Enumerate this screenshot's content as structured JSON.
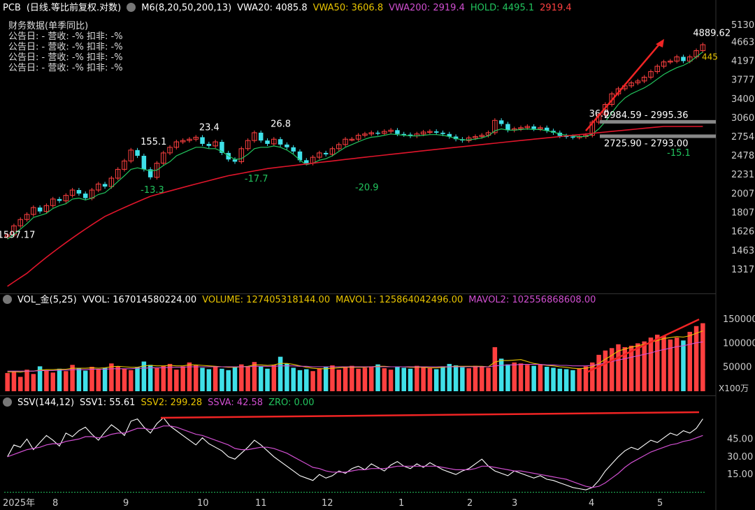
{
  "header": {
    "symbol": "PCB",
    "mode": "(日线.等比前复权.对数)",
    "m6": "M6(8,20,50,200,13)",
    "vwa20": "VWA20: 4085.8",
    "vwa50": "VWA50: 3606.8",
    "vwa200": "VWA200: 2919.4",
    "hold": "HOLD: 4495.1",
    "holdval": "2919.4"
  },
  "fin": {
    "title": "财务数据(单季同比)",
    "rows": [
      "公告日: -   营收: -%   扣非: -%",
      "公告日: -   营收: -%   扣非: -%",
      "公告日: -   营收: -%   扣非: -%",
      "公告日: -   营收: -%   扣非: -%"
    ]
  },
  "vol_header": {
    "name": "VOL_金(5,25)",
    "vvol": "VVOL: 167014580224.00",
    "volume": "VOLUME: 127405318144.00",
    "mavol1": "MAVOL1: 125864042496.00",
    "mavol2": "MAVOL2: 102556868608.00"
  },
  "ssv_header": {
    "name": "SSV(144,12)",
    "ssv1": "SSV1: 55.61",
    "ssv2": "SSV2: 299.28",
    "ssva": "SSVA: 42.58",
    "zro": "ZRO: 0.00"
  },
  "colors": {
    "up": "#ff4040",
    "down": "#3fe0e8",
    "green": "#22c55e",
    "ma200": "#e0152b",
    "yellow": "#e8c400",
    "magenta": "#d14fd1",
    "white": "#ffffff",
    "axis": "#cccccc",
    "arrow": "#f02424"
  },
  "chart_data": [
    {
      "type": "candlestick",
      "scale": "log",
      "ylim": [
        1190,
        5500
      ],
      "yticks": [
        1317,
        1463,
        1626,
        1807,
        2007,
        2231,
        2478,
        2754,
        3060,
        3400,
        3777,
        4197,
        4663,
        5130
      ],
      "xlabels": [
        "2025年",
        "8",
        "9",
        "10",
        "11",
        "12",
        "1",
        "2",
        "3",
        "4",
        "5"
      ],
      "close_series": [
        1597,
        1680,
        1740,
        1790,
        1860,
        1820,
        1880,
        1950,
        1930,
        1990,
        2050,
        2010,
        1960,
        2050,
        2120,
        2090,
        2190,
        2300,
        2410,
        2560,
        2480,
        2300,
        2200,
        2380,
        2520,
        2600,
        2680,
        2700,
        2720,
        2750,
        2650,
        2620,
        2680,
        2520,
        2430,
        2400,
        2580,
        2700,
        2820,
        2700,
        2650,
        2720,
        2640,
        2600,
        2540,
        2420,
        2380,
        2460,
        2520,
        2500,
        2580,
        2640,
        2720,
        2720,
        2780,
        2800,
        2820,
        2810,
        2840,
        2860,
        2800,
        2790,
        2770,
        2800,
        2830,
        2840,
        2820,
        2800,
        2760,
        2720,
        2700,
        2740,
        2760,
        2780,
        2820,
        3020,
        2960,
        2860,
        2880,
        2900,
        2920,
        2880,
        2900,
        2850,
        2820,
        2770,
        2760,
        2750,
        2760,
        2780,
        2990,
        3120,
        3300,
        3500,
        3600,
        3660,
        3720,
        3760,
        3840,
        3960,
        4080,
        4180,
        4200,
        4300,
        4200,
        4300,
        4450,
        4600
      ],
      "ma_green": [
        1560,
        1600,
        1650,
        1700,
        1760,
        1780,
        1800,
        1850,
        1880,
        1900,
        1950,
        1960,
        1940,
        1960,
        2000,
        2020,
        2080,
        2150,
        2220,
        2300,
        2320,
        2300,
        2280,
        2290,
        2350,
        2400,
        2480,
        2520,
        2560,
        2600,
        2600,
        2580,
        2580,
        2540,
        2480,
        2430,
        2440,
        2500,
        2580,
        2600,
        2600,
        2620,
        2600,
        2560,
        2500,
        2420,
        2360,
        2380,
        2420,
        2440,
        2480,
        2540,
        2600,
        2640,
        2680,
        2720,
        2750,
        2760,
        2780,
        2800,
        2790,
        2780,
        2770,
        2770,
        2780,
        2790,
        2790,
        2780,
        2760,
        2730,
        2710,
        2710,
        2720,
        2740,
        2770,
        2850,
        2880,
        2860,
        2860,
        2870,
        2880,
        2870,
        2870,
        2850,
        2830,
        2800,
        2780,
        2770,
        2760,
        2760,
        2800,
        2880,
        3000,
        3150,
        3300,
        3420,
        3500,
        3560,
        3620,
        3700,
        3800,
        3900,
        3980,
        4050,
        4100,
        4180,
        4300,
        4420
      ],
      "ma200": [
        1200,
        1230,
        1260,
        1290,
        1330,
        1370,
        1410,
        1450,
        1490,
        1530,
        1570,
        1610,
        1650,
        1690,
        1730,
        1770,
        1800,
        1830,
        1860,
        1890,
        1920,
        1950,
        1980,
        2000,
        2020,
        2040,
        2060,
        2080,
        2100,
        2120,
        2140,
        2160,
        2180,
        2200,
        2220,
        2235,
        2250,
        2265,
        2280,
        2295,
        2310,
        2320,
        2330,
        2340,
        2350,
        2360,
        2370,
        2380,
        2390,
        2400,
        2410,
        2420,
        2430,
        2440,
        2450,
        2460,
        2470,
        2480,
        2490,
        2500,
        2510,
        2520,
        2530,
        2540,
        2550,
        2560,
        2570,
        2580,
        2590,
        2600,
        2610,
        2620,
        2630,
        2640,
        2650,
        2660,
        2670,
        2680,
        2690,
        2700,
        2710,
        2720,
        2730,
        2740,
        2750,
        2760,
        2770,
        2780,
        2790,
        2800,
        2810,
        2820,
        2830,
        2840,
        2850,
        2860,
        2870,
        2880,
        2890,
        2900,
        2910,
        2920,
        2920,
        2920,
        2920,
        2920,
        2920,
        2920
      ],
      "labels": [
        {
          "text": "1597.17",
          "price": 1597,
          "idx": 0
        },
        {
          "text": "155.1",
          "price": 2680,
          "idx": 22
        },
        {
          "text": "-13.3",
          "price": 2050,
          "idx": 22
        },
        {
          "text": "23.4",
          "price": 2900,
          "idx": 31
        },
        {
          "text": "26.8",
          "price": 2960,
          "idx": 42
        },
        {
          "text": "-17.7",
          "price": 2180,
          "idx": 38
        },
        {
          "text": "-20.9",
          "price": 2080,
          "idx": 55
        },
        {
          "text": "36.0",
          "price": 3130,
          "idx": 91
        },
        {
          "text": "-15.1",
          "price": 2520,
          "idx": 103
        },
        {
          "text": "4889.62",
          "price": 4900,
          "idx": 140
        }
      ],
      "ranges": [
        {
          "text": "2984.59 - 2995.36",
          "price": 2990
        },
        {
          "text": "2725.90 - 2793.00",
          "price": 2760
        }
      ],
      "hold_label": "445"
    },
    {
      "type": "bar",
      "name": "VOL",
      "unit": "X100万",
      "yticks": [
        50000,
        100000,
        150000
      ],
      "ylim": [
        0,
        175000
      ],
      "values": [
        38000,
        41000,
        30000,
        45000,
        36000,
        52000,
        44000,
        39000,
        47000,
        42000,
        55000,
        48000,
        43000,
        51000,
        46000,
        49000,
        58000,
        52000,
        47000,
        44000,
        50000,
        62000,
        55000,
        48000,
        53000,
        57000,
        45000,
        52000,
        60000,
        54000,
        49000,
        46000,
        52000,
        47000,
        44000,
        50000,
        56000,
        51000,
        61000,
        52000,
        47000,
        55000,
        72000,
        58000,
        49000,
        44000,
        46000,
        42000,
        48000,
        51000,
        54000,
        45000,
        50000,
        53000,
        47000,
        49000,
        52000,
        56000,
        48000,
        45000,
        51000,
        49000,
        47000,
        53000,
        50000,
        48000,
        46000,
        52000,
        57000,
        54000,
        50000,
        48000,
        53000,
        51000,
        49000,
        92000,
        68000,
        56000,
        60000,
        58000,
        55000,
        53000,
        56000,
        51000,
        49000,
        47000,
        46000,
        44000,
        48000,
        52000,
        60000,
        76000,
        85000,
        90000,
        98000,
        92000,
        95000,
        100000,
        104000,
        112000,
        118000,
        115000,
        108000,
        112000,
        106000,
        124000,
        136000,
        142000
      ],
      "mavol1": [
        40000,
        41000,
        40000,
        42000,
        42000,
        44000,
        45000,
        45000,
        46000,
        46000,
        48000,
        48000,
        48000,
        49000,
        48000,
        49000,
        51000,
        52000,
        51000,
        50000,
        50000,
        53000,
        54000,
        53000,
        53000,
        54000,
        53000,
        53000,
        55000,
        55000,
        54000,
        53000,
        52000,
        51000,
        50000,
        50000,
        51000,
        52000,
        55000,
        55000,
        54000,
        55000,
        58000,
        58000,
        56000,
        53000,
        50000,
        48000,
        47000,
        47000,
        48000,
        49000,
        50000,
        50000,
        50000,
        50000,
        51000,
        52000,
        52000,
        51000,
        51000,
        51000,
        50000,
        50000,
        50000,
        49000,
        49000,
        50000,
        51000,
        52000,
        52000,
        52000,
        52000,
        52000,
        51000,
        61000,
        64000,
        64000,
        65000,
        66000,
        62000,
        58000,
        56000,
        54000,
        53000,
        51000,
        50000,
        48000,
        47000,
        48000,
        51000,
        58000,
        67000,
        75000,
        84000,
        88000,
        92000,
        95000,
        98000,
        102000,
        106000,
        110000,
        112000,
        114000,
        113000,
        116000,
        121000,
        126000
      ],
      "mavol2": [
        42000,
        42000,
        42000,
        42000,
        42000,
        43000,
        43000,
        43000,
        44000,
        44000,
        45000,
        45000,
        45000,
        46000,
        46000,
        46000,
        47000,
        47000,
        47000,
        47000,
        48000,
        48000,
        49000,
        49000,
        49000,
        50000,
        50000,
        50000,
        51000,
        51000,
        51000,
        51000,
        51000,
        51000,
        51000,
        51000,
        51000,
        51000,
        52000,
        52000,
        52000,
        52000,
        53000,
        53000,
        53000,
        52000,
        52000,
        51000,
        51000,
        51000,
        51000,
        51000,
        51000,
        51000,
        51000,
        51000,
        51000,
        51000,
        51000,
        51000,
        51000,
        51000,
        51000,
        51000,
        51000,
        51000,
        51000,
        51000,
        51000,
        51000,
        51000,
        51000,
        51000,
        51000,
        51000,
        53000,
        54000,
        55000,
        55000,
        56000,
        56000,
        56000,
        56000,
        55000,
        55000,
        54000,
        54000,
        53000,
        53000,
        53000,
        54000,
        56000,
        59000,
        62000,
        65000,
        68000,
        71000,
        74000,
        77000,
        80000,
        84000,
        87000,
        90000,
        93000,
        95000,
        98000,
        101000,
        103000
      ]
    },
    {
      "type": "line",
      "name": "SSV",
      "yticks": [
        15.0,
        30.0,
        45.0
      ],
      "ylim": [
        -2,
        70
      ],
      "ssv1": [
        30,
        40,
        38,
        45,
        36,
        42,
        48,
        44,
        39,
        50,
        47,
        52,
        55,
        49,
        44,
        51,
        57,
        53,
        48,
        60,
        62,
        55,
        50,
        58,
        63,
        56,
        52,
        48,
        44,
        40,
        46,
        41,
        38,
        35,
        30,
        28,
        33,
        38,
        44,
        40,
        35,
        30,
        26,
        22,
        18,
        14,
        12,
        10,
        15,
        12,
        14,
        18,
        16,
        20,
        22,
        19,
        24,
        21,
        18,
        23,
        26,
        22,
        20,
        24,
        21,
        25,
        22,
        19,
        17,
        15,
        18,
        20,
        24,
        28,
        22,
        18,
        16,
        14,
        18,
        16,
        14,
        12,
        14,
        11,
        10,
        8,
        6,
        4,
        3,
        2,
        4,
        10,
        18,
        24,
        30,
        35,
        38,
        36,
        40,
        44,
        42,
        46,
        50,
        48,
        52,
        50,
        54,
        62
      ],
      "ssva": [
        30,
        32,
        34,
        36,
        37,
        38,
        40,
        41,
        41,
        43,
        44,
        45,
        47,
        47,
        46,
        47,
        49,
        50,
        50,
        52,
        54,
        54,
        53,
        54,
        56,
        56,
        55,
        53,
        51,
        49,
        48,
        46,
        44,
        42,
        40,
        37,
        36,
        36,
        37,
        38,
        38,
        37,
        35,
        33,
        30,
        27,
        24,
        21,
        20,
        18,
        17,
        17,
        17,
        18,
        19,
        19,
        20,
        20,
        20,
        21,
        22,
        22,
        22,
        22,
        22,
        22,
        22,
        21,
        20,
        19,
        19,
        19,
        20,
        22,
        22,
        21,
        20,
        19,
        18,
        18,
        17,
        16,
        15,
        14,
        13,
        12,
        11,
        9,
        7,
        5,
        4,
        5,
        8,
        12,
        16,
        21,
        25,
        28,
        31,
        34,
        36,
        38,
        40,
        41,
        43,
        44,
        46,
        48
      ]
    }
  ]
}
